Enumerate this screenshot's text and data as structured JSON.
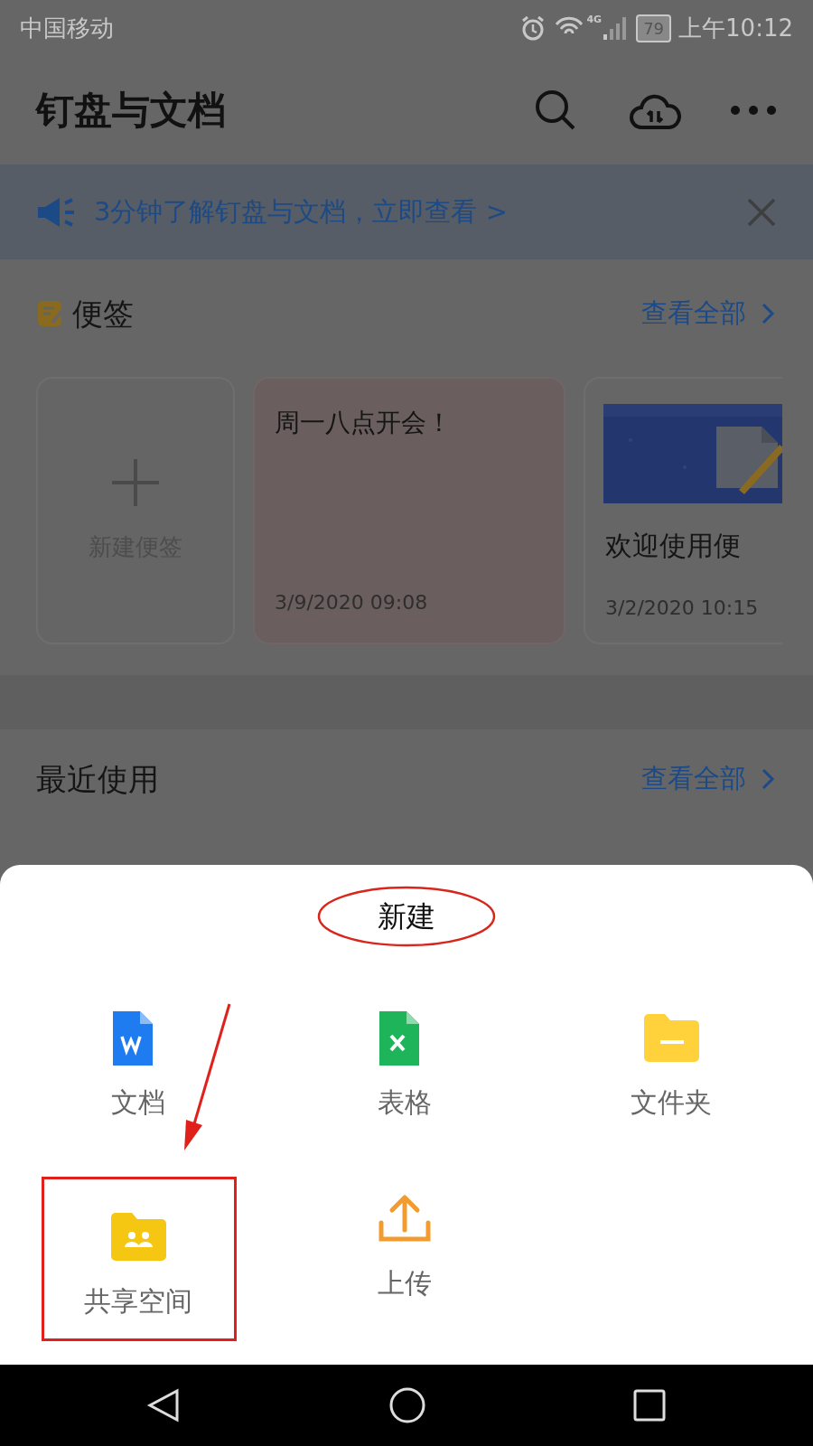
{
  "status_bar": {
    "carrier": "中国移动",
    "network": "4G",
    "battery": "79",
    "time": "上午10:12"
  },
  "header": {
    "title": "钉盘与文档"
  },
  "banner": {
    "text": "3分钟了解钉盘与文档，立即查看 >"
  },
  "notes": {
    "title": "便签",
    "view_all": "查看全部",
    "cards": [
      {
        "kind": "new",
        "label": "新建便签"
      },
      {
        "kind": "text",
        "title": "周一八点开会！",
        "date": "3/9/2020 09:08"
      },
      {
        "title": "欢迎使用便",
        "date": "3/2/2020 10:15"
      }
    ]
  },
  "recent": {
    "title": "最近使用",
    "view_all": "查看全部"
  },
  "sheet": {
    "title": "新建",
    "circled": true,
    "items": [
      {
        "kind": "doc",
        "label": "文档",
        "boxed": false
      },
      {
        "kind": "sheet",
        "label": "表格",
        "boxed": false
      },
      {
        "kind": "folder",
        "label": "文件夹",
        "boxed": false
      },
      {
        "kind": "shared",
        "label": "共享空间",
        "boxed": true
      },
      {
        "kind": "upload",
        "label": "上传",
        "boxed": false
      }
    ]
  }
}
